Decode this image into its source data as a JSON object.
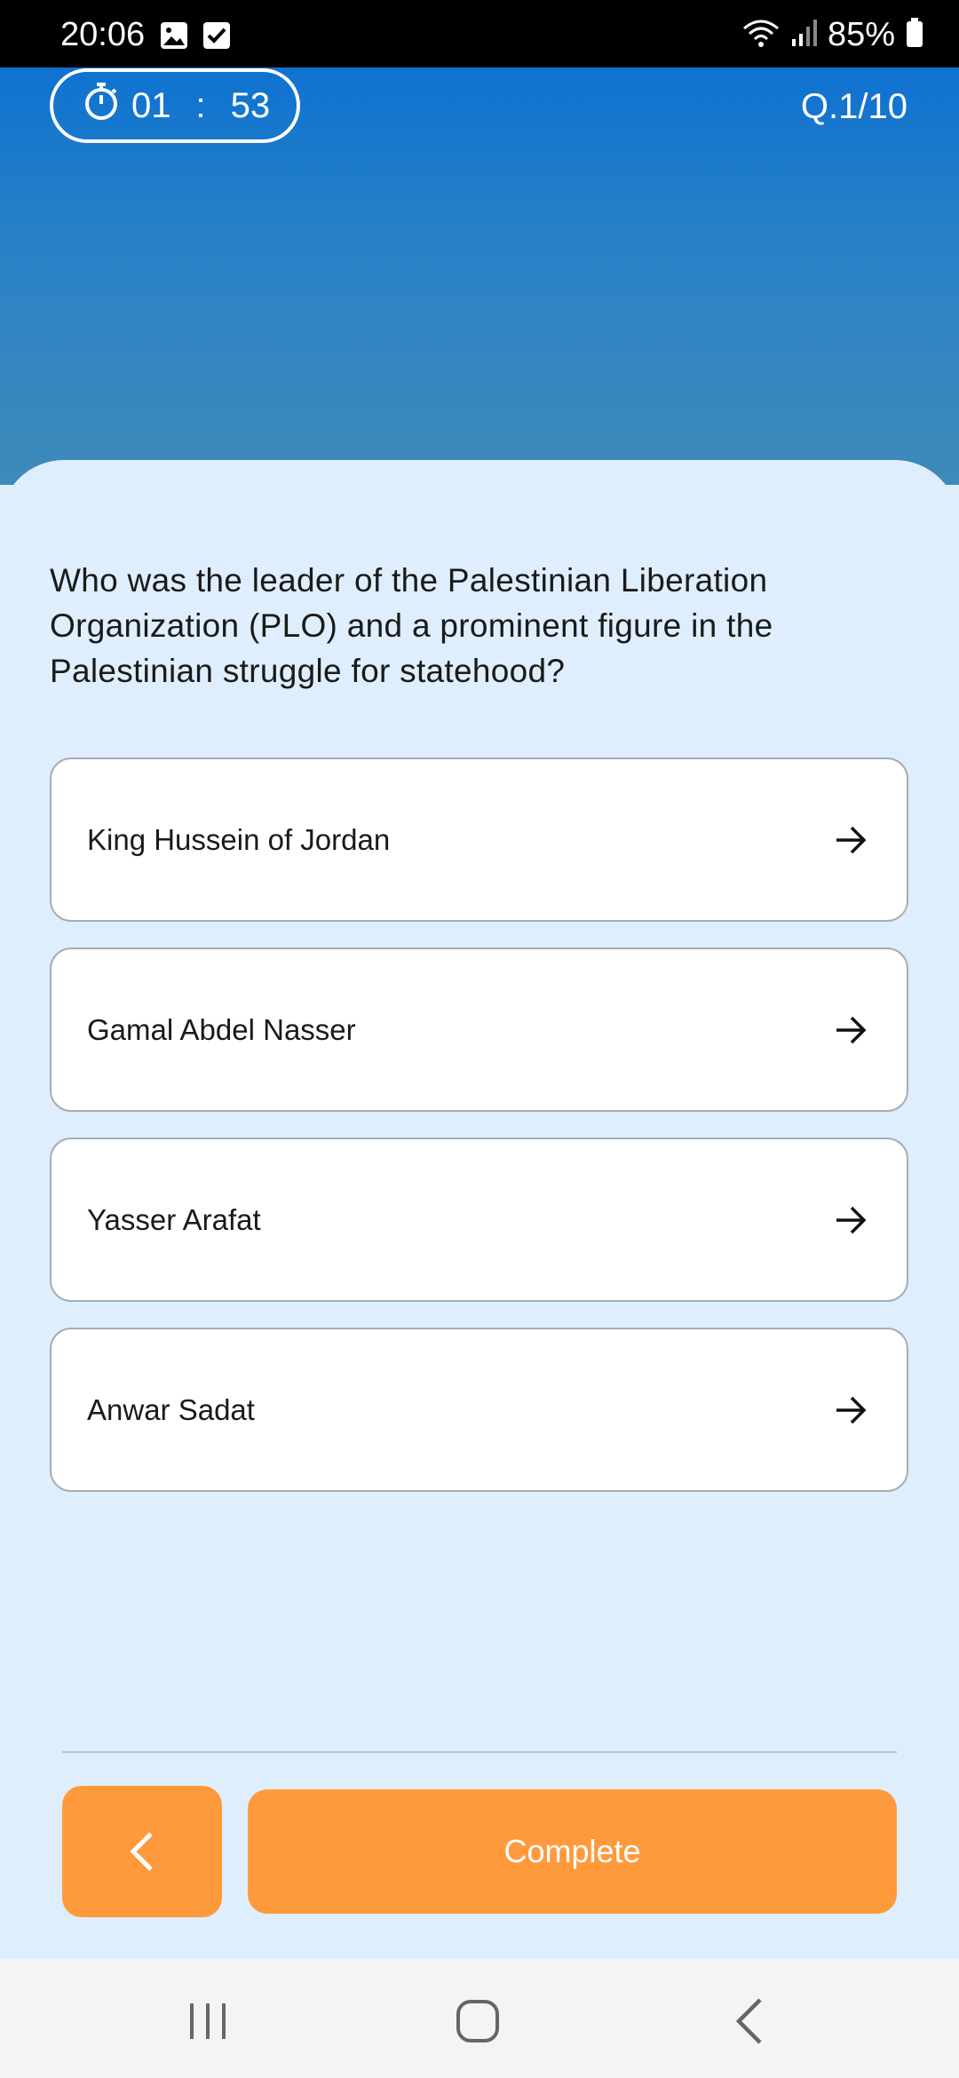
{
  "status_bar": {
    "time": "20:06",
    "battery": "85%"
  },
  "header": {
    "timer_minutes": "01",
    "timer_separator": ":",
    "timer_seconds": "53",
    "question_counter": "Q.1/10"
  },
  "question": {
    "text": "Who was the leader of the Palestinian Liberation Organization (PLO) and a prominent figure in the Palestinian struggle for statehood?"
  },
  "options": [
    {
      "label": "King Hussein of Jordan"
    },
    {
      "label": "Gamal Abdel Nasser"
    },
    {
      "label": "Yasser Arafat"
    },
    {
      "label": "Anwar Sadat"
    }
  ],
  "footer": {
    "complete_label": "Complete"
  },
  "colors": {
    "header_top": "#0e72d0",
    "card_background": "#dfeefc",
    "accent": "#ff9a3c"
  },
  "icons": [
    "stopwatch-icon",
    "arrow-right-icon",
    "chevron-left-icon",
    "recent-apps-icon",
    "home-icon",
    "back-icon",
    "wifi-icon",
    "signal-icon",
    "battery-icon",
    "gallery-icon",
    "check-icon"
  ]
}
